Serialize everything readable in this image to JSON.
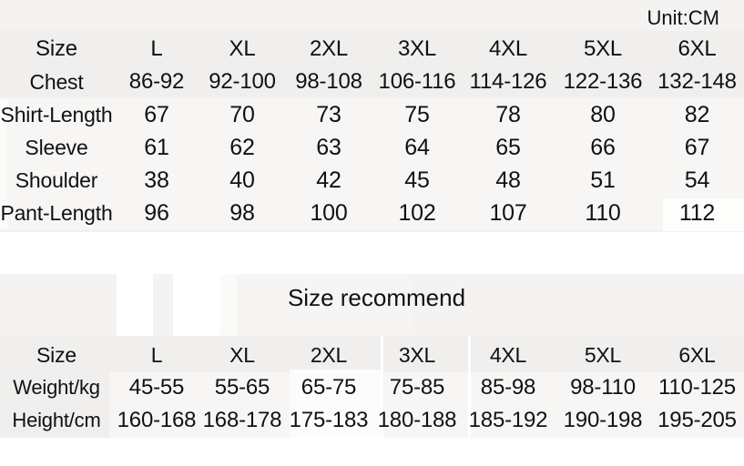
{
  "unit_note": "Unit:CM",
  "section_title": "Size recommend",
  "colors": {
    "page_background": "#ffffff",
    "table_background": "#f2f1ef",
    "band_highlight": "#fcfcfb",
    "text": "#111111"
  },
  "measurement_table": {
    "label_header": "Size",
    "sizes": [
      "L",
      "XL",
      "2XL",
      "3XL",
      "4XL",
      "5XL",
      "6XL"
    ],
    "rows": [
      {
        "label": "Chest",
        "values": [
          "86-92",
          "92-100",
          "98-108",
          "106-116",
          "114-126",
          "122-136",
          "132-148"
        ]
      },
      {
        "label": "Shirt-Length",
        "values": [
          "67",
          "70",
          "73",
          "75",
          "78",
          "80",
          "82"
        ]
      },
      {
        "label": "Sleeve",
        "values": [
          "61",
          "62",
          "63",
          "64",
          "65",
          "66",
          "67"
        ]
      },
      {
        "label": "Shoulder",
        "values": [
          "38",
          "40",
          "42",
          "45",
          "48",
          "51",
          "54"
        ]
      },
      {
        "label": "Pant-Length",
        "values": [
          "96",
          "98",
          "100",
          "102",
          "107",
          "110",
          "112"
        ]
      }
    ]
  },
  "recommend_table": {
    "label_header": "Size",
    "sizes": [
      "L",
      "XL",
      "2XL",
      "3XL",
      "4XL",
      "5XL",
      "6XL"
    ],
    "rows": [
      {
        "label": "Weight/kg",
        "values": [
          "45-55",
          "55-65",
          "65-75",
          "75-85",
          "85-98",
          "98-110",
          "110-125"
        ]
      },
      {
        "label": "Height/cm",
        "values": [
          "160-168",
          "168-178",
          "175-183",
          "180-188",
          "185-192",
          "190-198",
          "195-205"
        ]
      }
    ]
  }
}
